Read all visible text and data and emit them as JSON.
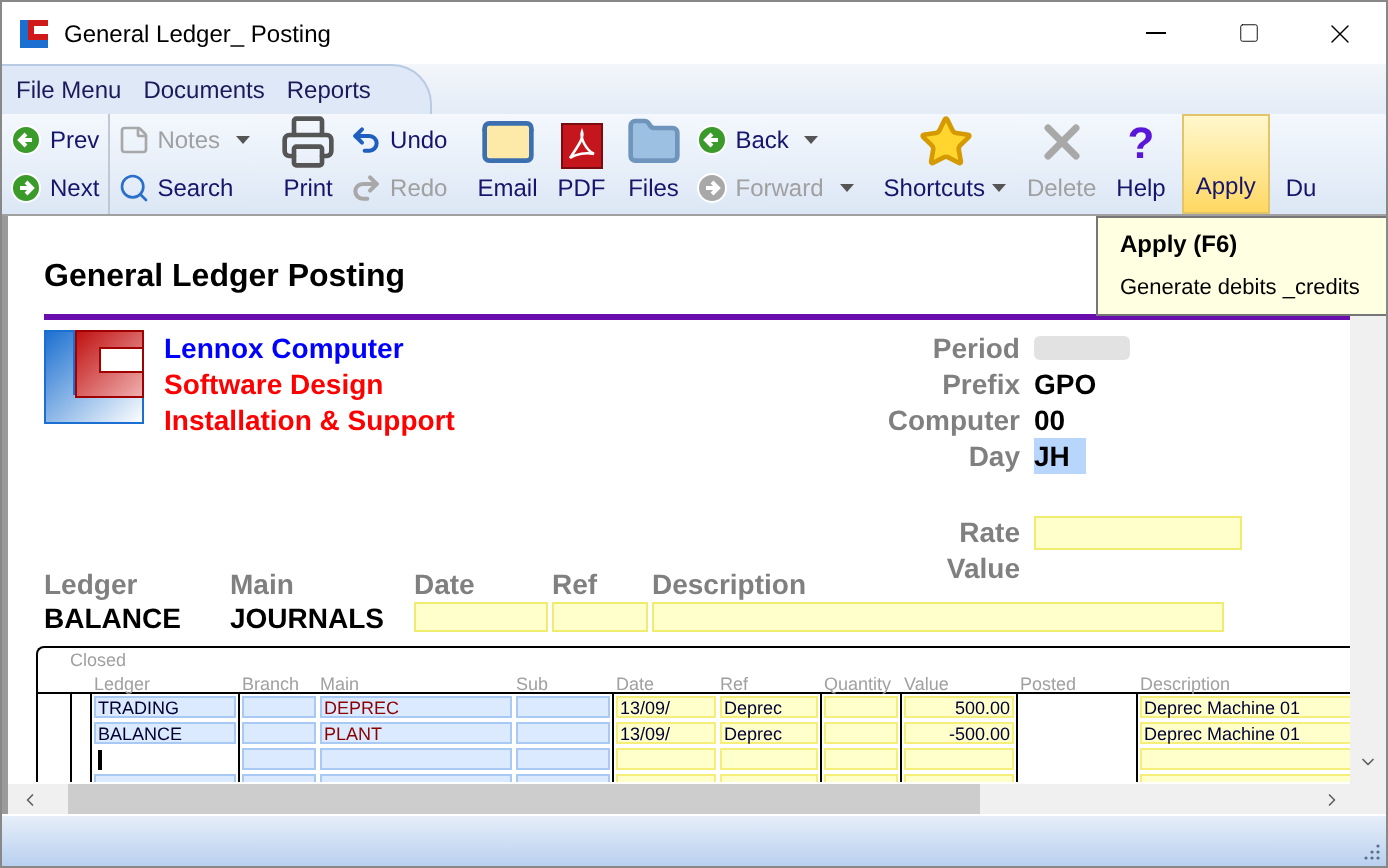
{
  "window": {
    "title": "General Ledger_ Posting"
  },
  "menu": [
    {
      "label": "File Menu"
    },
    {
      "label": "Documents"
    },
    {
      "label": "Reports"
    }
  ],
  "toolbar": [
    {
      "kind": "stack",
      "items": [
        {
          "label": "Prev",
          "disabled": false,
          "dropdown": false
        },
        {
          "label": "Next",
          "disabled": false,
          "dropdown": false
        }
      ]
    },
    {
      "kind": "stack",
      "items": [
        {
          "label": "Notes",
          "disabled": true,
          "dropdown": true
        },
        {
          "label": "Search",
          "disabled": false,
          "dropdown": false
        }
      ]
    },
    {
      "kind": "large",
      "label": "Print",
      "disabled": false,
      "dropdown": false,
      "highlighted": false
    },
    {
      "kind": "stack",
      "items": [
        {
          "label": "Undo",
          "disabled": false,
          "dropdown": false
        },
        {
          "label": "Redo",
          "disabled": true,
          "dropdown": false
        }
      ]
    },
    {
      "kind": "large",
      "label": "Email",
      "disabled": false,
      "dropdown": false,
      "highlighted": false
    },
    {
      "kind": "large",
      "label": "PDF",
      "disabled": false,
      "dropdown": false,
      "highlighted": false
    },
    {
      "kind": "large",
      "label": "Files",
      "disabled": false,
      "dropdown": false,
      "highlighted": false
    },
    {
      "kind": "stack",
      "items": [
        {
          "label": "Back",
          "disabled": false,
          "dropdown": true
        },
        {
          "label": "Forward",
          "disabled": true,
          "dropdown": true
        }
      ]
    },
    {
      "kind": "large",
      "label": "Shortcuts",
      "disabled": false,
      "dropdown": true,
      "highlighted": false
    },
    {
      "kind": "large",
      "label": "Delete",
      "disabled": true,
      "dropdown": false,
      "highlighted": false
    },
    {
      "kind": "large",
      "label": "Help",
      "glyph": "?",
      "disabled": false,
      "dropdown": false,
      "highlighted": false
    },
    {
      "kind": "large",
      "label": "Apply",
      "disabled": false,
      "dropdown": false,
      "highlighted": true
    },
    {
      "kind": "large",
      "label": "Du",
      "disabled": false,
      "dropdown": false,
      "highlighted": false
    }
  ],
  "tooltip": {
    "title": "Apply (F6)",
    "text": "Generate debits _credits"
  },
  "form": {
    "title": "General Ledger Posting",
    "company": [
      {
        "text": "Lennox Computer",
        "color": "#0000ff"
      },
      {
        "text": "Software Design",
        "color": "#ff0000"
      },
      {
        "text": "Installation & Support",
        "color": "#ff0000"
      }
    ],
    "details": [
      {
        "label": "Period",
        "kind": "redacted"
      },
      {
        "label": "Prefix",
        "kind": "text",
        "value": "GPO"
      },
      {
        "label": "Computer",
        "kind": "text",
        "value": "00"
      },
      {
        "label": "Day",
        "kind": "field",
        "value": "JH"
      },
      {
        "label": "Rate",
        "kind": "input"
      },
      {
        "label": "Value",
        "kind": "label"
      }
    ],
    "posting": [
      {
        "label": "Ledger",
        "value": "BALANCE"
      },
      {
        "label": "Main",
        "value": "JOURNALS"
      },
      {
        "label": "Date"
      },
      {
        "label": "Ref"
      },
      {
        "label": "Description"
      }
    ]
  },
  "grid": {
    "caption": "Closed",
    "columns": [
      "Ledger",
      "Branch",
      "Main",
      "Sub",
      "Date",
      "Ref",
      "Quantity",
      "Value",
      "Posted",
      "Description"
    ],
    "rows": [
      {
        "selected": false,
        "ledger": "TRADING",
        "main": "DEPREC",
        "date": "13/09/",
        "ref": "Deprec",
        "value": "500.00",
        "description": "Deprec Machine 01"
      },
      {
        "selected": false,
        "ledger": "BALANCE",
        "main": "PLANT",
        "date": "13/09/",
        "ref": "Deprec",
        "value": "-500.00",
        "description": "Deprec Machine 01"
      },
      {
        "selected": true
      },
      {
        "selected": false
      }
    ]
  }
}
